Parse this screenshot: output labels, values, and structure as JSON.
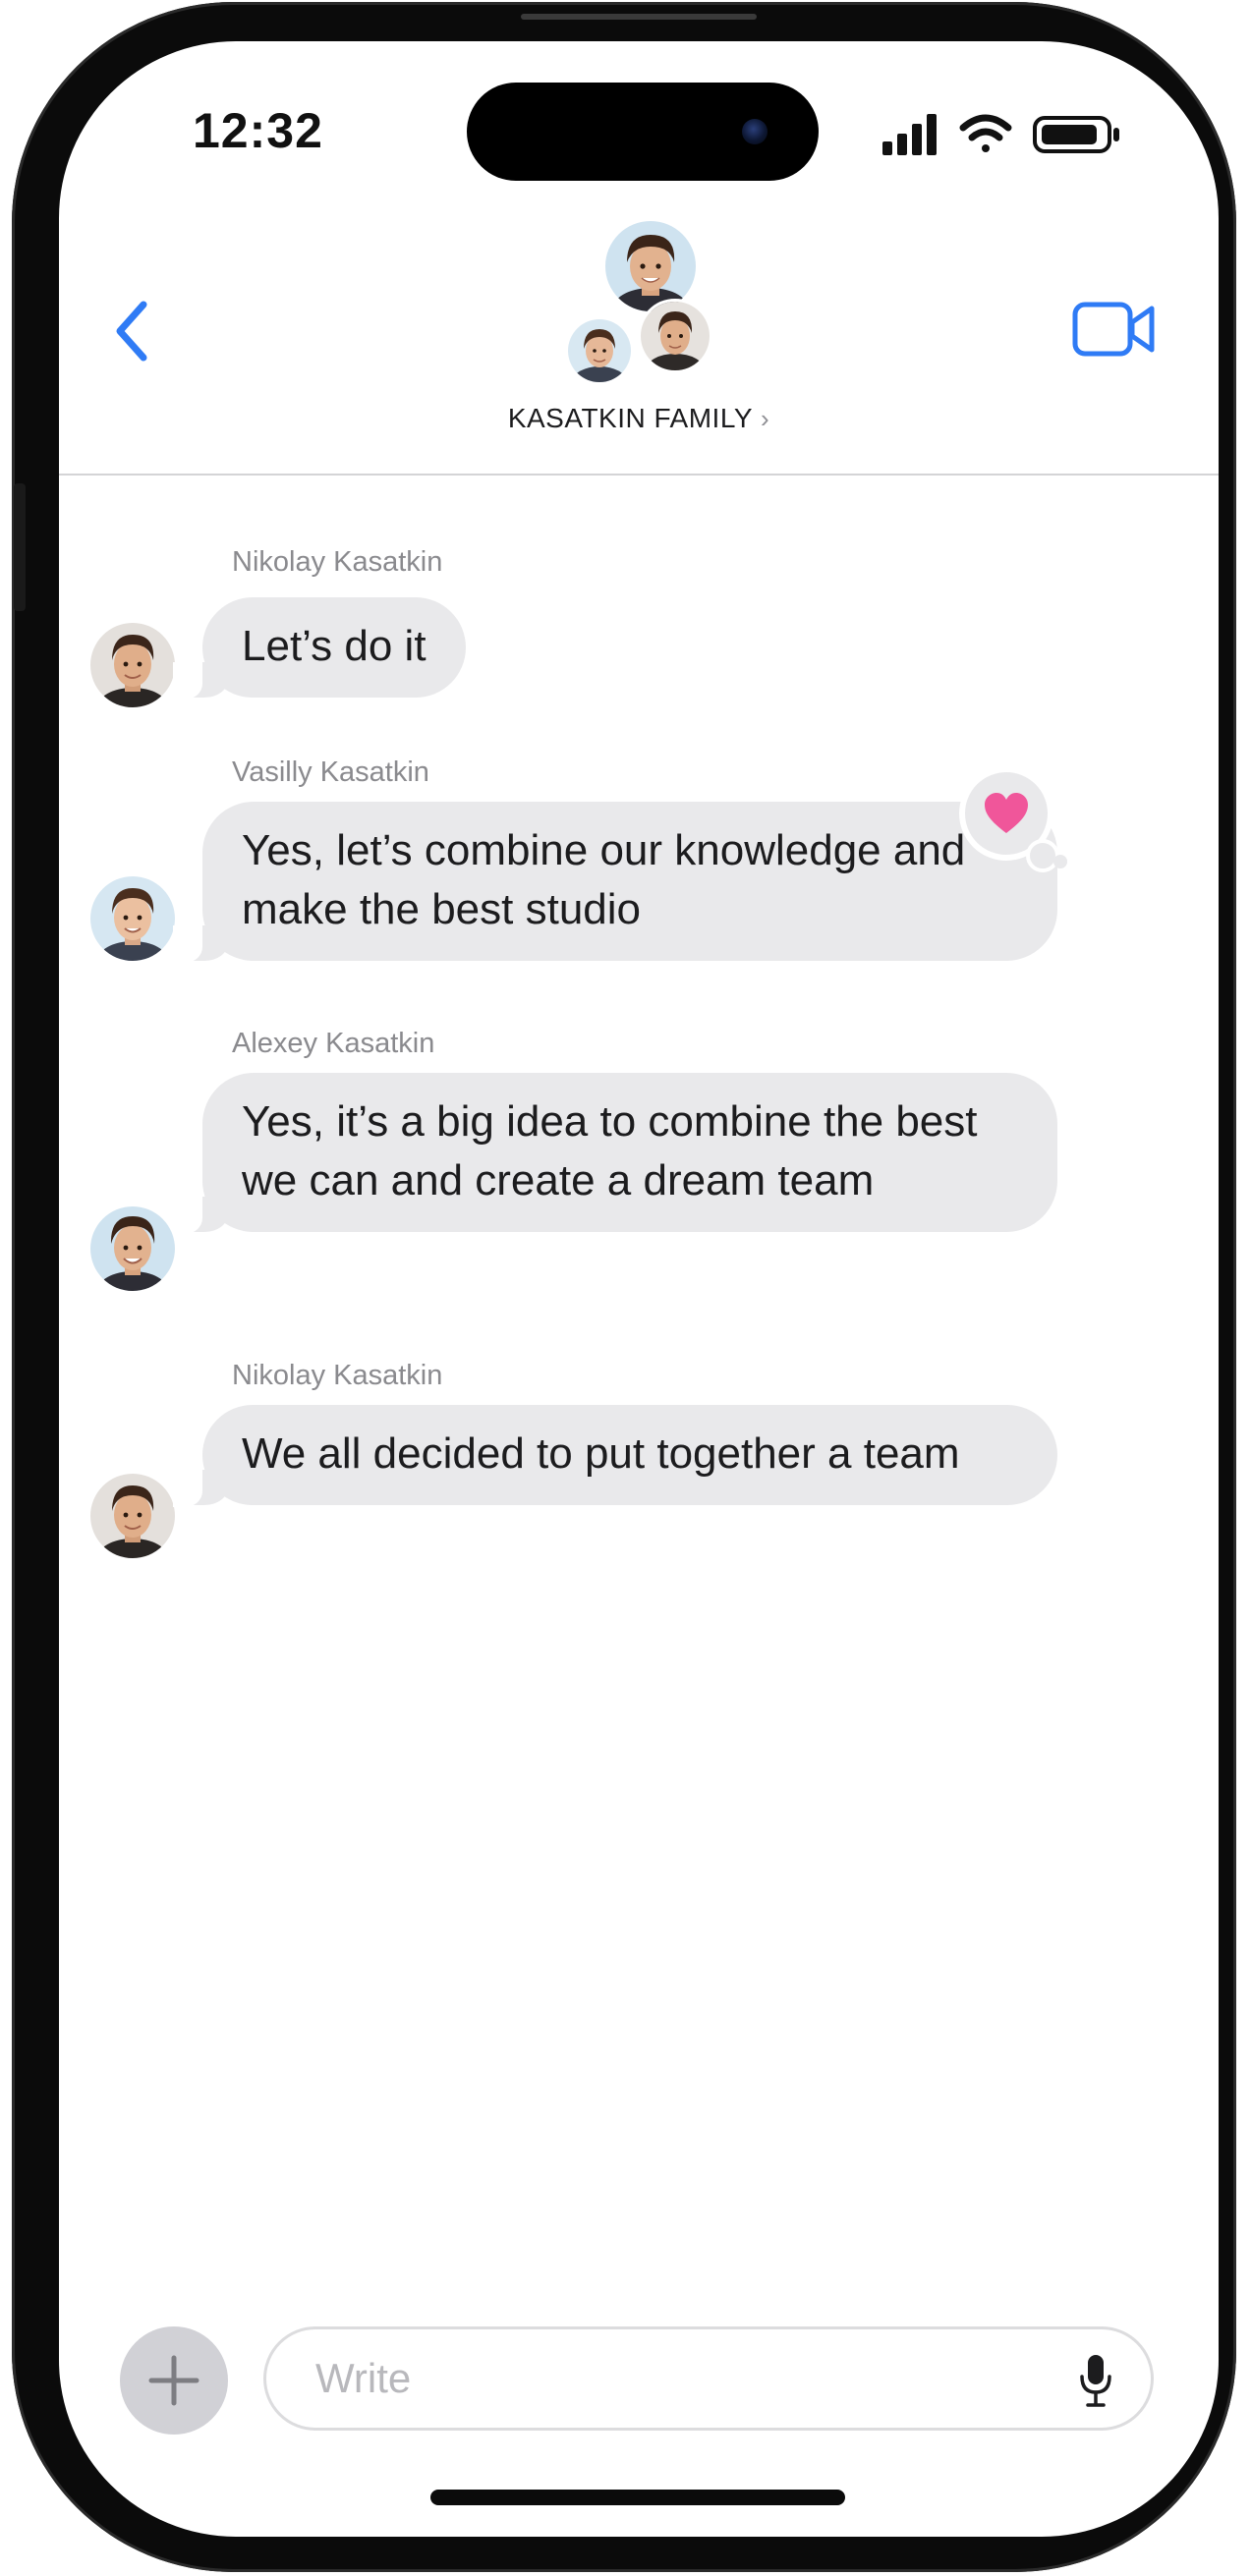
{
  "status_bar": {
    "time": "12:32"
  },
  "header": {
    "group_name": "KASATKIN FAMILY",
    "chevron": "›",
    "back_icon": "chevron-left-icon",
    "video_icon": "video-camera-icon"
  },
  "messages": [
    {
      "sender": "Nikolay Kasatkin",
      "text": "Let’s do it"
    },
    {
      "sender": "Vasilly Kasatkin",
      "text": "Yes, let’s combine our knowledge and make the best studio",
      "reaction": "heart-icon"
    },
    {
      "sender": "Alexey Kasatkin",
      "text": "Yes, it’s a big idea to combine the best we can and create a dream team"
    },
    {
      "sender": "Nikolay Kasatkin",
      "text": "We all decided to put together a team"
    }
  ],
  "composer": {
    "placeholder": "Write",
    "plus_icon": "plus-icon",
    "mic_icon": "microphone-icon"
  },
  "colors": {
    "accent": "#2f7bf5",
    "bubble": "#e9e9eb",
    "reaction_heart": "#f0569a"
  }
}
